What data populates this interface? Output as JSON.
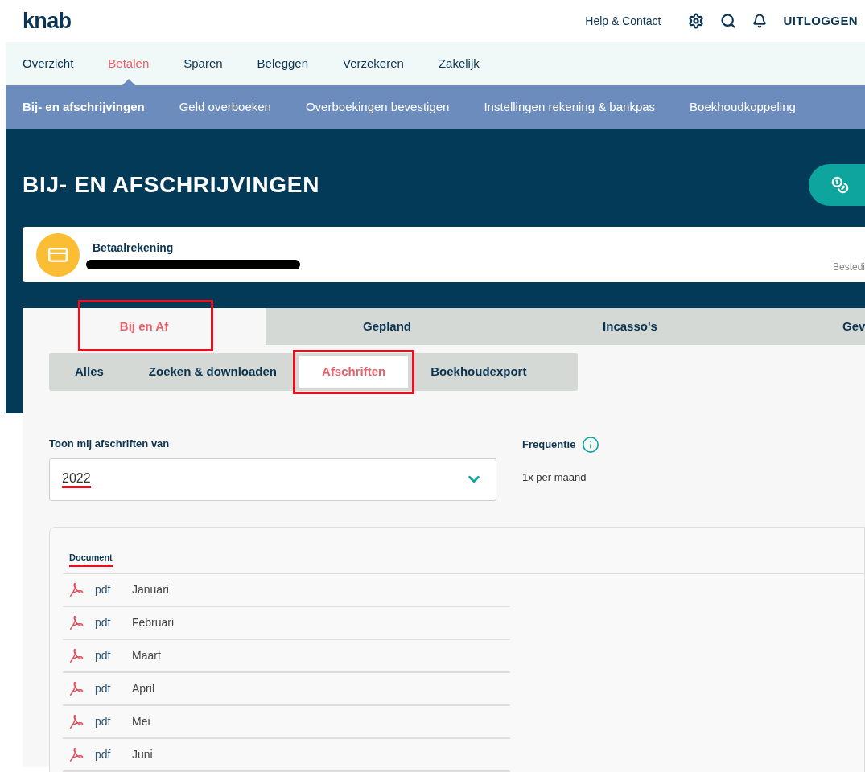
{
  "header": {
    "logo": "knab",
    "help_link": "Help & Contact",
    "logout": "UITLOGGEN"
  },
  "main_nav": [
    {
      "label": "Overzicht",
      "selected": false
    },
    {
      "label": "Betalen",
      "selected": true
    },
    {
      "label": "Sparen",
      "selected": false
    },
    {
      "label": "Beleggen",
      "selected": false
    },
    {
      "label": "Verzekeren",
      "selected": false
    },
    {
      "label": "Zakelijk",
      "selected": false
    }
  ],
  "sub_nav": [
    {
      "label": "Bij- en afschrijvingen",
      "selected": true
    },
    {
      "label": "Geld overboeken",
      "selected": false
    },
    {
      "label": "Overboekingen bevestigen",
      "selected": false
    },
    {
      "label": "Instellingen rekening & bankpas",
      "selected": false
    },
    {
      "label": "Boekhoudkoppeling",
      "selected": false
    }
  ],
  "page_title": "BIJ- EN AFSCHRIJVINGEN",
  "account": {
    "name": "Betaalrekening",
    "number_redacted": true,
    "side_label": "Bestedi"
  },
  "tabs": [
    {
      "label": "Bij en Af",
      "selected": true,
      "annotated": true
    },
    {
      "label": "Gepland",
      "selected": false,
      "annotated": false
    },
    {
      "label": "Incasso's",
      "selected": false,
      "annotated": false
    },
    {
      "label": "Gev",
      "selected": false,
      "annotated": false
    }
  ],
  "subtabs": [
    {
      "label": "Alles",
      "selected": false,
      "annotated": false
    },
    {
      "label": "Zoeken & downloaden",
      "selected": false,
      "annotated": false
    },
    {
      "label": "Afschriften",
      "selected": true,
      "annotated": true
    },
    {
      "label": "Boekhoudexport",
      "selected": false,
      "annotated": false
    }
  ],
  "period": {
    "label": "Toon mij afschriften van",
    "value": "2022",
    "underlined": true
  },
  "frequency": {
    "label": "Frequentie",
    "value": "1x per maand"
  },
  "table": {
    "header": "Document",
    "header_underlined": true,
    "rows": [
      {
        "type": "pdf",
        "month": "Januari"
      },
      {
        "type": "pdf",
        "month": "Februari"
      },
      {
        "type": "pdf",
        "month": "Maart"
      },
      {
        "type": "pdf",
        "month": "April"
      },
      {
        "type": "pdf",
        "month": "Mei"
      },
      {
        "type": "pdf",
        "month": "Juni"
      }
    ]
  }
}
